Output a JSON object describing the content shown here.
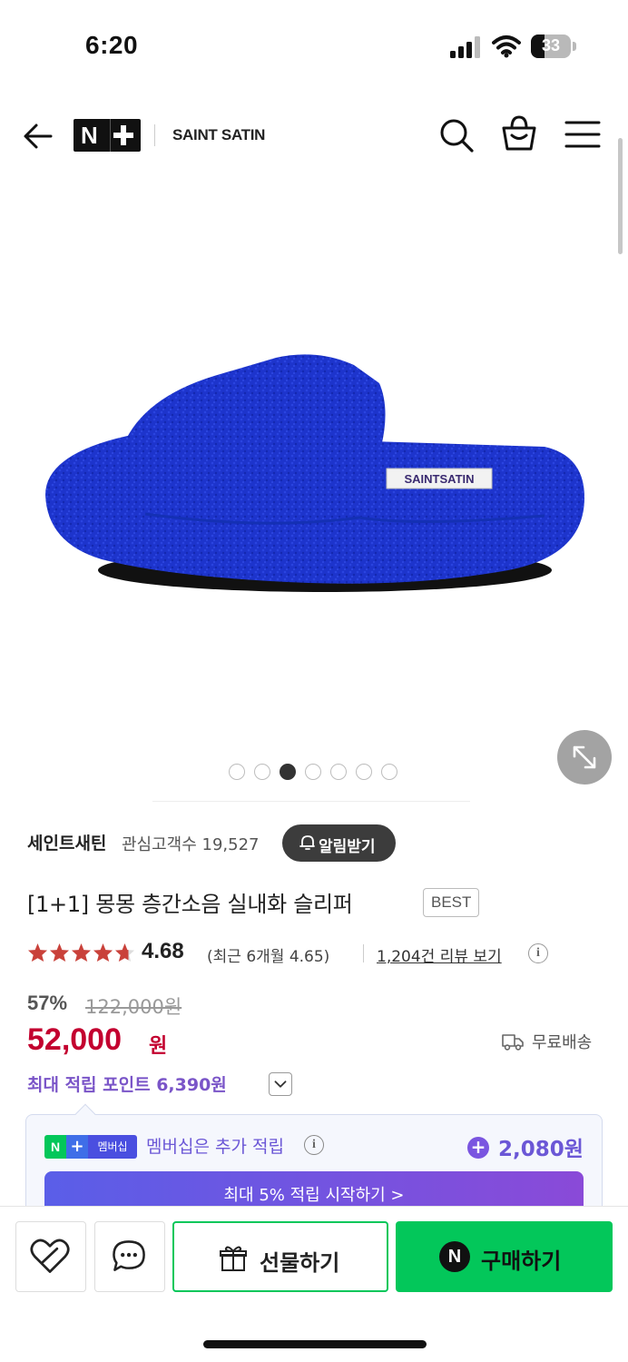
{
  "status_bar": {
    "time": "6:20",
    "battery": "33",
    "battery_level": 0.33
  },
  "nav": {
    "back_icon": "arrow-left-icon",
    "logo_text": "N",
    "brand": "SAINT SATIN",
    "icons": [
      "search-icon",
      "shopping-bag-icon",
      "hamburger-menu-icon"
    ]
  },
  "gallery": {
    "total_images": 7,
    "active_index": 2,
    "product_label": "SAINTSATIN",
    "expand_icon": "expand-arrows-icon"
  },
  "store": {
    "name": "세인트새틴",
    "favorites": "관심고객수 19,527",
    "alert_button": "알림받기"
  },
  "product": {
    "title": "[1+1] 몽몽 층간소음 실내화 슬리퍼",
    "badge": "BEST",
    "rating": "4.68",
    "rating_stars": 4.68,
    "rating_recent": "(최근 6개월 4.65)",
    "review_link": "1,204건 리뷰 보기",
    "discount_rate": "57%",
    "original_price": "122,000원",
    "sale_price": "52,000",
    "sale_unit": "원",
    "shipping": "무료배송",
    "max_points": "최대 적립 포인트 6,390원"
  },
  "membership": {
    "badge_text": "멤버십",
    "text": "멤버십은 추가 적립",
    "points": "2,080원",
    "cta": "최대 5% 적립 시작하기 >"
  },
  "bottom_bar": {
    "gift_label": "선물하기",
    "buy_label": "구매하기",
    "buy_icon_text": "N"
  },
  "colors": {
    "accent_green": "#03c75a",
    "sale_red": "#c3002f",
    "point_purple": "#7a55c8",
    "product_blue": "#1a2fc8"
  }
}
